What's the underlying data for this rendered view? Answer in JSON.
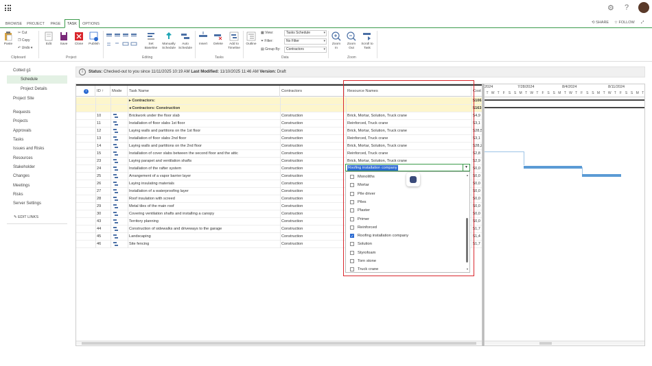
{
  "suite": {
    "icons": [
      "gear-icon",
      "help-icon"
    ]
  },
  "tabs": [
    "BROWSE",
    "PROJECT",
    "PAGE",
    "TASK",
    "OPTIONS"
  ],
  "active_tab": "TASK",
  "share": {
    "share_label": "SHARE",
    "follow_label": "FOLLOW"
  },
  "ribbon": {
    "clipboard": {
      "paste": "Paste",
      "cut": "Cut",
      "copy": "Copy",
      "undo": "Undo",
      "group": "Clipboard"
    },
    "project": {
      "edit": "Edit",
      "save": "Save",
      "close": "Close",
      "publish": "Publish",
      "group": "Project"
    },
    "editing": {
      "set_baseline_1": "Set",
      "set_baseline_2": "Baseline",
      "manually_1": "Manually",
      "manually_2": "Schedule",
      "auto_1": "Auto",
      "auto_2": "Schedule",
      "group": "Editing"
    },
    "tasks": {
      "insert": "Insert",
      "delete": "Delete",
      "add_timeline_1": "Add to",
      "add_timeline_2": "Timeline",
      "group": "Tasks"
    },
    "data": {
      "outline": "Outline",
      "view": "View:",
      "filter": "Filter:",
      "group_by": "Group By:",
      "view_value": "Tasks Schedule",
      "filter_value": "No Filter",
      "group_value": "Contractors",
      "group": "Data"
    },
    "zoom": {
      "zoom_in_1": "Zoom",
      "zoom_in_2": "In",
      "zoom_out_1": "Zoom",
      "zoom_out_2": "Out",
      "scroll_1": "Scroll to",
      "scroll_2": "Task",
      "group": "Zoom"
    }
  },
  "leftnav": {
    "project": "Cotted g1",
    "items": [
      "Schedule",
      "Project Details",
      "Project Site",
      "Requests",
      "Projects",
      "Approvals",
      "Tasks",
      "Issues and Risks",
      "Resources",
      "Stakeholder",
      "Changes",
      "Meetings",
      "Risks",
      "Server Settings"
    ],
    "edit_links": "EDIT LINKS"
  },
  "status": {
    "label": "Status:",
    "text": "Checked-out to you since 11/11/2025 10:19 AM",
    "last_label": "Last Modified:",
    "last_value": "11/10/2025 11:46 AM",
    "version_label": "Version:",
    "version_value": "Draft"
  },
  "grid": {
    "headers": {
      "id": "ID ↑",
      "mode": "Mode",
      "task_name": "Task Name",
      "contractors": "Contractors",
      "resource_names": "Resource Names",
      "cost": "Cost"
    },
    "summary_rows": [
      {
        "name": "Contractors:",
        "cost": "$106"
      },
      {
        "name": "Contractors: Construction",
        "cost": "$163"
      }
    ],
    "rows": [
      {
        "id": "10",
        "name": "Brickwork under the floor slab",
        "contractor": "Construction",
        "resources": "Brick, Mortar, Solution, Truck crane",
        "cost": "$4,9"
      },
      {
        "id": "11",
        "name": "Installation of floor slabs 1st floor",
        "contractor": "Construction",
        "resources": "Reinforced, Truck crane",
        "cost": "$3,1"
      },
      {
        "id": "12",
        "name": "Laying walls and partitions on the 1st floor",
        "contractor": "Construction",
        "resources": "Brick, Mortar, Solution, Truck crane",
        "cost": "$28,5"
      },
      {
        "id": "13",
        "name": "Installation of floor slabs 2nd floor",
        "contractor": "Construction",
        "resources": "Reinforced, Truck crane",
        "cost": "$3,1"
      },
      {
        "id": "14",
        "name": "Laying walls and partitions on the 2nd floor",
        "contractor": "Construction",
        "resources": "Brick, Mortar, Solution, Truck crane",
        "cost": "$28,2"
      },
      {
        "id": "15",
        "name": "Installation of cover slabs between the second floor and the attic",
        "contractor": "Construction",
        "resources": "Reinforced, Truck crane",
        "cost": "$2,8"
      },
      {
        "id": "23",
        "name": "Laying parapet and ventilation shafts",
        "contractor": "Construction",
        "resources": "Brick, Mortar, Solution, Truck crane",
        "cost": "$2,9"
      },
      {
        "id": "24",
        "name": "Installation of the rafter system",
        "contractor": "Construction",
        "resources": "",
        "cost": "$0,0"
      },
      {
        "id": "25",
        "name": "Arrangement of a vapor barrier layer",
        "contractor": "Construction",
        "resources": "",
        "cost": "$0,0"
      },
      {
        "id": "26",
        "name": "Laying insulating materials",
        "contractor": "Construction",
        "resources": "",
        "cost": "$0,0"
      },
      {
        "id": "27",
        "name": "Installation of a waterproofing layer",
        "contractor": "Construction",
        "resources": "",
        "cost": "$0,0"
      },
      {
        "id": "28",
        "name": "Roof insulation with screed",
        "contractor": "Construction",
        "resources": "",
        "cost": "$0,0"
      },
      {
        "id": "29",
        "name": "Metal tiles of the main roof",
        "contractor": "Construction",
        "resources": "",
        "cost": "$0,0"
      },
      {
        "id": "30",
        "name": "Covering ventilation shafts and installing a canopy",
        "contractor": "Construction",
        "resources": "",
        "cost": "$0,0"
      },
      {
        "id": "43",
        "name": "Territory planning",
        "contractor": "Construction",
        "resources": "",
        "cost": "$0,0"
      },
      {
        "id": "44",
        "name": "Construction of sidewalks and driveways to the garage",
        "contractor": "Construction",
        "resources": "",
        "cost": "$1,7"
      },
      {
        "id": "45",
        "name": "Landscaping",
        "contractor": "Construction",
        "resources": "",
        "cost": "$1,4"
      },
      {
        "id": "46",
        "name": "Site fencing",
        "contractor": "Construction",
        "resources": "",
        "cost": "$1,7"
      }
    ]
  },
  "editor": {
    "value": "Roofing installation company",
    "options": [
      {
        "label": "Monoliths",
        "checked": false
      },
      {
        "label": "Mortar",
        "checked": false
      },
      {
        "label": "Pile driver",
        "checked": false
      },
      {
        "label": "Piles",
        "checked": false
      },
      {
        "label": "Plaster",
        "checked": false
      },
      {
        "label": "Primer",
        "checked": false
      },
      {
        "label": "Reinforced",
        "checked": false
      },
      {
        "label": "Roofing installation company",
        "checked": true
      },
      {
        "label": "Solution",
        "checked": false
      },
      {
        "label": "Styrofoam",
        "checked": false
      },
      {
        "label": "Torn stone",
        "checked": false
      },
      {
        "label": "Truck crane",
        "checked": false
      }
    ]
  },
  "gantt": {
    "weeks": [
      "2024",
      "7/28/2024",
      "8/4/2024",
      "8/11/2024"
    ],
    "days": [
      "T",
      "W",
      "T",
      "F",
      "S",
      "S",
      "M",
      "T",
      "W",
      "T",
      "F",
      "S",
      "S",
      "M",
      "T",
      "W",
      "T",
      "F",
      "S",
      "S",
      "M",
      "T",
      "W",
      "T",
      "F",
      "S",
      "S",
      "M",
      "T"
    ]
  },
  "colors": {
    "accent_green": "#3a9a4a",
    "summary_yellow": "#fdf6cc",
    "select_blue": "#2b6ad1",
    "highlight_red": "#d9262c",
    "gantt_blue": "#5b9bd5"
  }
}
